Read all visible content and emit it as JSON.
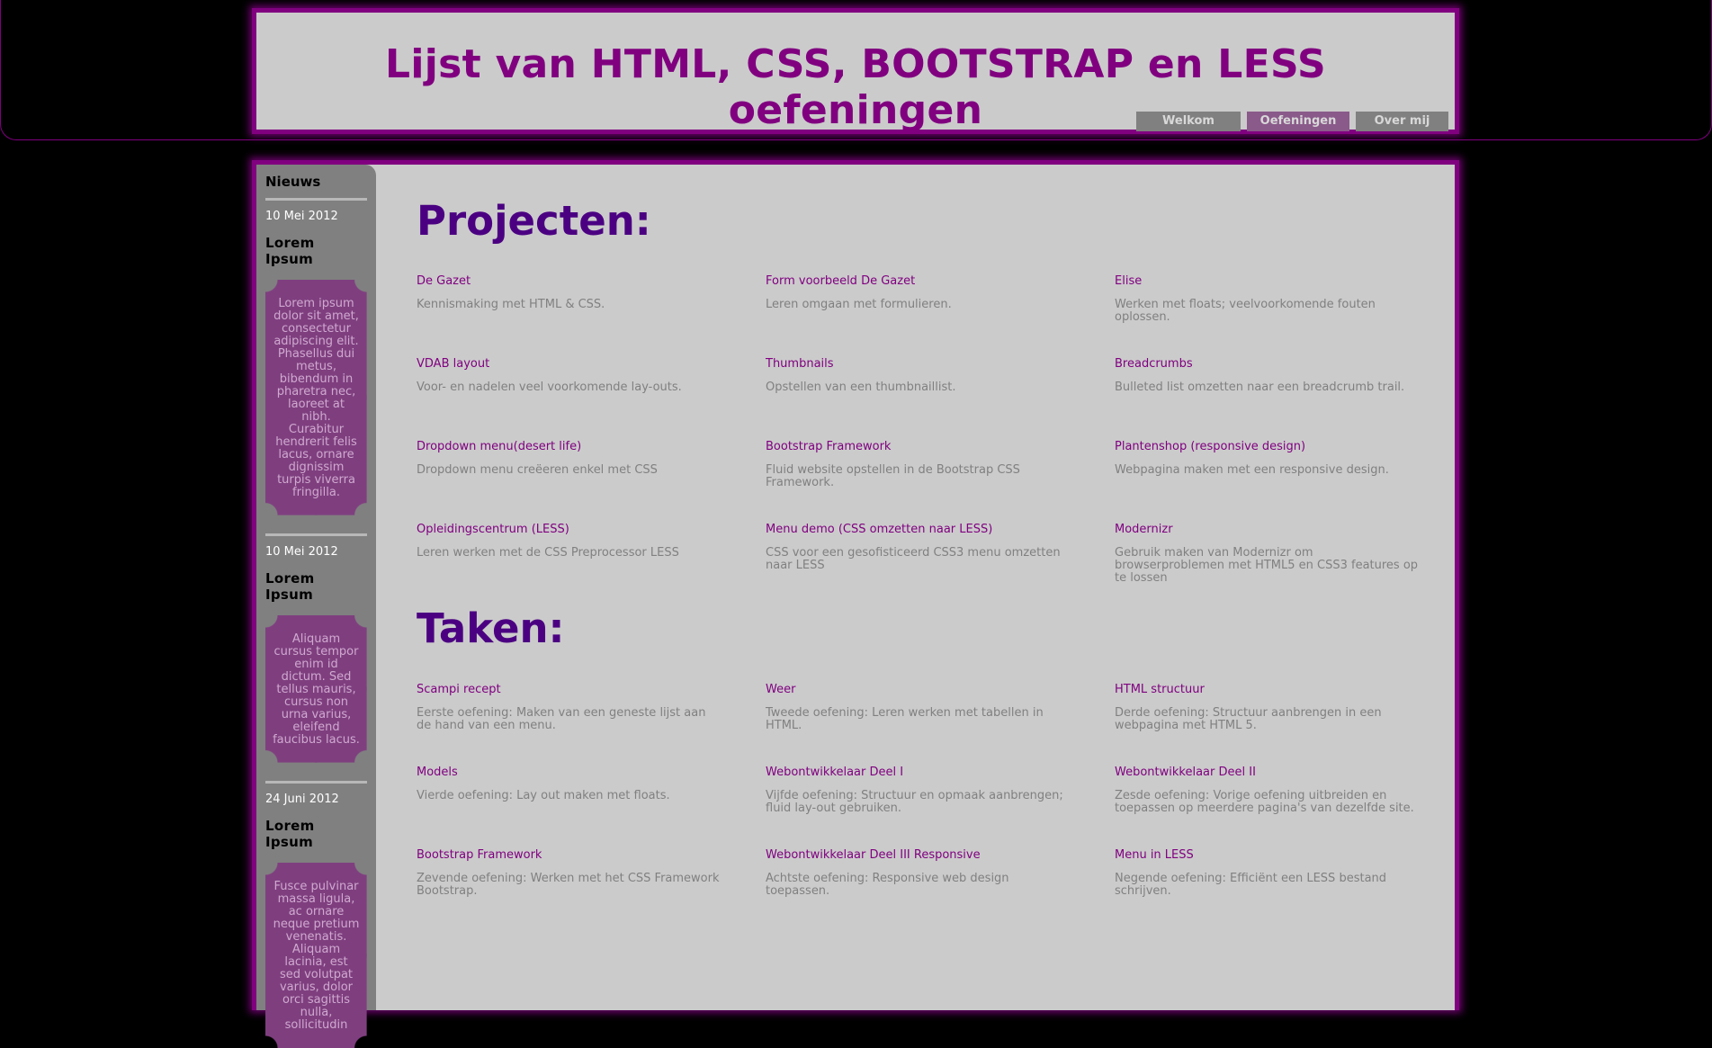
{
  "header": {
    "title": "Lijst van HTML, CSS, BOOTSTRAP en LESS oefeningen"
  },
  "nav": [
    {
      "label": "Welkom"
    },
    {
      "label": "Oefeningen",
      "active": true
    },
    {
      "label": "Over mij"
    }
  ],
  "sidebar": {
    "heading": "Nieuws",
    "news": [
      {
        "date": "10 Mei 2012",
        "title": "Lorem Ipsum",
        "text": "Lorem ipsum dolor sit amet, consectetur adipiscing elit. Phasellus dui metus, bibendum in pharetra nec, laoreet at nibh. Curabitur hendrerit felis lacus, ornare dignissim turpis viverra fringilla."
      },
      {
        "date": "10 Mei 2012",
        "title": "Lorem Ipsum",
        "text": "Aliquam cursus tempor enim id dictum. Sed tellus mauris, cursus non urna varius, eleifend faucibus lacus."
      },
      {
        "date": "24 Juni 2012",
        "title": "Lorem Ipsum",
        "text": "Fusce pulvinar massa ligula, ac ornare neque pretium venenatis. Aliquam lacinia, est sed volutpat varius, dolor orci sagittis nulla, sollicitudin"
      }
    ]
  },
  "projects": {
    "heading": "Projecten:",
    "items": [
      {
        "title": "De Gazet",
        "desc": "Kennismaking met HTML & CSS."
      },
      {
        "title": "Form voorbeeld De Gazet",
        "desc": "Leren omgaan met formulieren."
      },
      {
        "title": "Elise",
        "desc": "Werken met floats; veelvoorkomende fouten oplossen."
      },
      {
        "title": "VDAB layout",
        "desc": "Voor- en nadelen veel voorkomende lay-outs."
      },
      {
        "title": "Thumbnails",
        "desc": "Opstellen van een thumbnaillist."
      },
      {
        "title": "Breadcrumbs",
        "desc": "Bulleted list omzetten naar een breadcrumb trail."
      },
      {
        "title": "Dropdown menu(desert life)",
        "desc": "Dropdown menu creëeren enkel met CSS"
      },
      {
        "title": "Bootstrap Framework",
        "desc": "Fluid website opstellen in de Bootstrap CSS Framework."
      },
      {
        "title": "Plantenshop (responsive design)",
        "desc": "Webpagina maken met een responsive design."
      },
      {
        "title": "Opleidingscentrum (LESS)",
        "desc": "Leren werken met de CSS Preprocessor LESS"
      },
      {
        "title": "Menu demo (CSS omzetten naar LESS)",
        "desc": "CSS voor een gesofisticeerd CSS3 menu omzetten naar LESS"
      },
      {
        "title": "Modernizr",
        "desc": "Gebruik maken van Modernizr om browserproblemen met HTML5 en CSS3 features op te lossen"
      }
    ]
  },
  "tasks": {
    "heading": "Taken:",
    "items": [
      {
        "title": "Scampi recept",
        "desc": "Eerste oefening: Maken van een geneste lijst aan de hand van een menu."
      },
      {
        "title": "Weer",
        "desc": "Tweede oefening: Leren werken met tabellen in HTML."
      },
      {
        "title": "HTML structuur",
        "desc": "Derde oefening: Structuur aanbrengen in een webpagina met HTML 5."
      },
      {
        "title": "Models",
        "desc": "Vierde oefening: Lay out maken met floats."
      },
      {
        "title": "Webontwikkelaar Deel I",
        "desc": "Vijfde oefening: Structuur en opmaak aanbrengen; fluid lay-out gebruiken."
      },
      {
        "title": "Webontwikkelaar Deel II",
        "desc": "Zesde oefening: Vorige oefening uitbreiden en toepassen op meerdere pagina's van dezelfde site."
      },
      {
        "title": "Bootstrap Framework",
        "desc": "Zevende oefening: Werken met het CSS Framework Bootstrap."
      },
      {
        "title": "Webontwikkelaar Deel III Responsive",
        "desc": "Achtste oefening: Responsive web design toepassen."
      },
      {
        "title": "Menu in LESS",
        "desc": "Negende oefening: Efficiënt een LESS bestand schrijven."
      }
    ]
  }
}
